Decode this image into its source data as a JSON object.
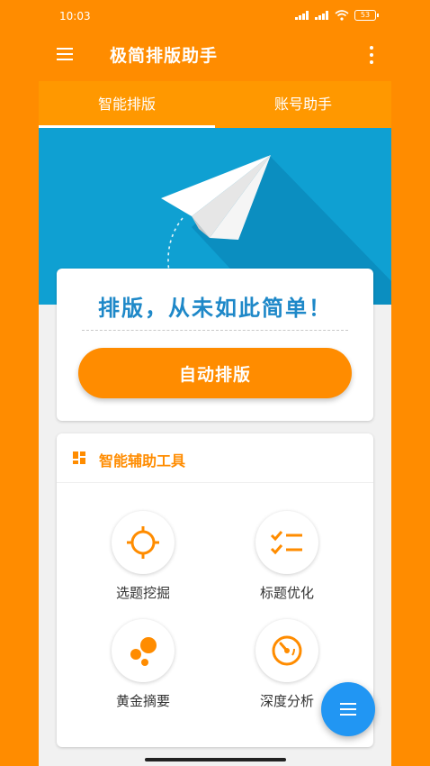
{
  "status_bar": {
    "time": "10:03",
    "battery": "53"
  },
  "app_bar": {
    "title": "极简排版助手",
    "menu_icon": "hamburger-menu-icon",
    "more_icon": "more-vertical-icon"
  },
  "tabs": [
    {
      "label": "智能排版",
      "active": true
    },
    {
      "label": "账号助手",
      "active": false
    }
  ],
  "hero": {
    "illustration": "paper-plane-icon",
    "slogan": "排版，从未如此简单！",
    "button_label": "自动排版"
  },
  "tools": {
    "title": "智能辅助工具",
    "icon": "grid-icon",
    "items": [
      {
        "label": "选题挖掘",
        "icon": "crosshair-icon"
      },
      {
        "label": "标题优化",
        "icon": "checklist-icon"
      },
      {
        "label": "黄金摘要",
        "icon": "bubbles-icon"
      },
      {
        "label": "深度分析",
        "icon": "gauge-icon"
      }
    ]
  },
  "fab": {
    "icon": "menu-icon"
  },
  "colors": {
    "primary": "#FF8C00",
    "tab_bar": "#FF9800",
    "hero_bg": "#0FA0D2",
    "slogan": "#1E88C8",
    "fab": "#2196F3"
  }
}
